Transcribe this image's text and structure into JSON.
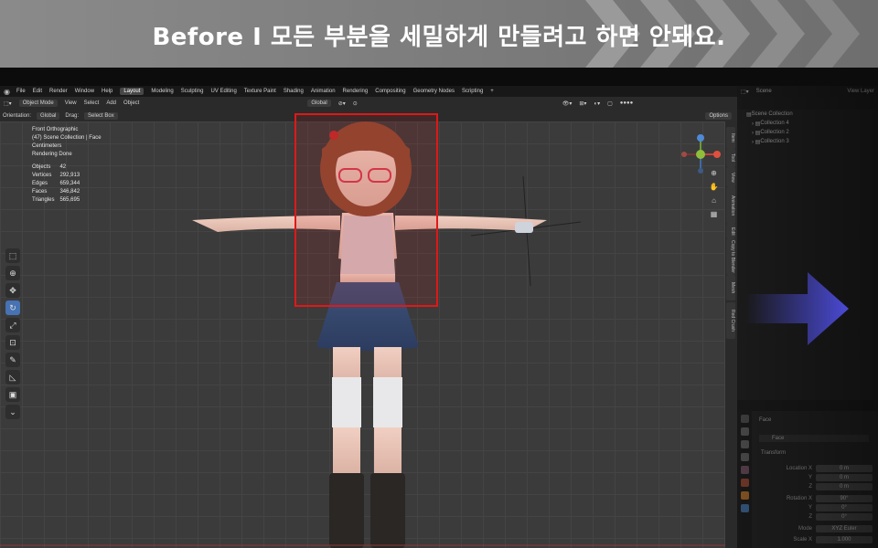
{
  "banner": {
    "title": "Before  I  모든 부분을 세밀하게 만들려고 하면 안돼요."
  },
  "menu": {
    "items": [
      "File",
      "Edit",
      "Render",
      "Window",
      "Help"
    ],
    "workspaces": [
      "Layout",
      "Modeling",
      "Sculpting",
      "UV Editing",
      "Texture Paint",
      "Shading",
      "Animation",
      "Rendering",
      "Compositing",
      "Geometry Nodes",
      "Scripting"
    ],
    "active_workspace": "Layout",
    "add_tab": "+"
  },
  "header": {
    "mode": "Object Mode",
    "items": [
      "View",
      "Select",
      "Add",
      "Object"
    ],
    "transform": "Global",
    "orientation_label": "Orientation:",
    "orientation_value": "Global",
    "drag_label": "Drag:",
    "drag_value": "Select Box",
    "options": "Options"
  },
  "overlay": {
    "view": "Front Orthographic",
    "collection": "(47) Scene Collection | Face",
    "units": "Centimeters",
    "status": "Rendering Done"
  },
  "stats": [
    {
      "label": "Objects",
      "value": "42"
    },
    {
      "label": "Vertices",
      "value": "292,913"
    },
    {
      "label": "Edges",
      "value": "659,344"
    },
    {
      "label": "Faces",
      "value": "346,842"
    },
    {
      "label": "Triangles",
      "value": "565,695"
    }
  ],
  "sidebar_tabs": [
    "Item",
    "Tool",
    "View",
    "Animation",
    "Edit",
    "Copy to Blender",
    "Mesh",
    "Red Crush"
  ],
  "outliner": {
    "scene": "Scene",
    "view_layer": "View Layer",
    "root": "Scene Collection",
    "collections": [
      "Collection 4",
      "Collection 2",
      "Collection 3"
    ]
  },
  "properties": {
    "object_name": "Face",
    "mesh_name": "Face",
    "section": "Transform",
    "rows": [
      {
        "label": "Location X",
        "value": "0 m"
      },
      {
        "label": "Y",
        "value": "0 m"
      },
      {
        "label": "Z",
        "value": "0 m"
      },
      {
        "label": "Rotation X",
        "value": "90°"
      },
      {
        "label": "Y",
        "value": "0°"
      },
      {
        "label": "Z",
        "value": "0°"
      },
      {
        "label": "Mode",
        "value": "XYZ Euler"
      },
      {
        "label": "Scale X",
        "value": "1.000"
      }
    ]
  },
  "colors": {
    "accent": "#4772b3",
    "highlight_box": "#e01818",
    "arrow": "#4b4bd6"
  }
}
